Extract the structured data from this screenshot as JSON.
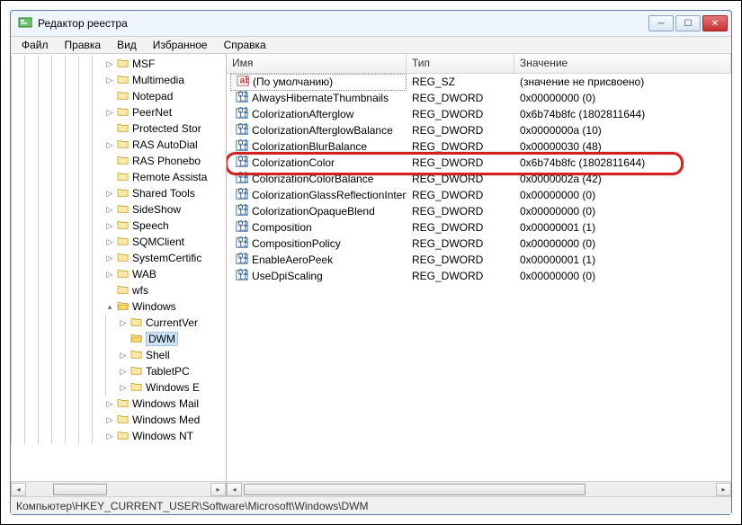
{
  "window": {
    "title": "Редактор реестра"
  },
  "menu": {
    "file": "Файл",
    "edit": "Правка",
    "view": "Вид",
    "favorites": "Избранное",
    "help": "Справка"
  },
  "columns": {
    "name": "Имя",
    "type": "Тип",
    "value": "Значение"
  },
  "tree": {
    "items": [
      {
        "label": "MSF",
        "depth": 7,
        "exp": "▷"
      },
      {
        "label": "Multimedia",
        "depth": 7,
        "exp": "▷"
      },
      {
        "label": "Notepad",
        "depth": 7,
        "exp": ""
      },
      {
        "label": "PeerNet",
        "depth": 7,
        "exp": "▷"
      },
      {
        "label": "Protected Stor",
        "depth": 7,
        "exp": ""
      },
      {
        "label": "RAS AutoDial",
        "depth": 7,
        "exp": "▷"
      },
      {
        "label": "RAS Phonebo",
        "depth": 7,
        "exp": ""
      },
      {
        "label": "Remote Assista",
        "depth": 7,
        "exp": ""
      },
      {
        "label": "Shared Tools",
        "depth": 7,
        "exp": "▷"
      },
      {
        "label": "SideShow",
        "depth": 7,
        "exp": "▷"
      },
      {
        "label": "Speech",
        "depth": 7,
        "exp": "▷"
      },
      {
        "label": "SQMClient",
        "depth": 7,
        "exp": "▷"
      },
      {
        "label": "SystemCertific",
        "depth": 7,
        "exp": "▷"
      },
      {
        "label": "WAB",
        "depth": 7,
        "exp": "▷"
      },
      {
        "label": "wfs",
        "depth": 7,
        "exp": ""
      },
      {
        "label": "Windows",
        "depth": 7,
        "exp": "▴",
        "open": true
      },
      {
        "label": "CurrentVer",
        "depth": 8,
        "exp": "▷"
      },
      {
        "label": "DWM",
        "depth": 8,
        "exp": "",
        "selected": true,
        "open": true
      },
      {
        "label": "Shell",
        "depth": 8,
        "exp": "▷"
      },
      {
        "label": "TabletPC",
        "depth": 8,
        "exp": "▷"
      },
      {
        "label": "Windows E",
        "depth": 8,
        "exp": "▷"
      },
      {
        "label": "Windows Mail",
        "depth": 7,
        "exp": "▷"
      },
      {
        "label": "Windows Med",
        "depth": 7,
        "exp": "▷"
      },
      {
        "label": "Windows NT",
        "depth": 7,
        "exp": "▷"
      }
    ]
  },
  "values": [
    {
      "icon": "sz",
      "name": "(По умолчанию)",
      "type": "REG_SZ",
      "value": "(значение не присвоено)",
      "selected": true
    },
    {
      "icon": "dw",
      "name": "AlwaysHibernateThumbnails",
      "type": "REG_DWORD",
      "value": "0x00000000 (0)"
    },
    {
      "icon": "dw",
      "name": "ColorizationAfterglow",
      "type": "REG_DWORD",
      "value": "0x6b74b8fc (1802811644)"
    },
    {
      "icon": "dw",
      "name": "ColorizationAfterglowBalance",
      "type": "REG_DWORD",
      "value": "0x0000000a (10)"
    },
    {
      "icon": "dw",
      "name": "ColorizationBlurBalance",
      "type": "REG_DWORD",
      "value": "0x00000030 (48)"
    },
    {
      "icon": "dw",
      "name": "ColorizationColor",
      "type": "REG_DWORD",
      "value": "0x6b74b8fc (1802811644)",
      "highlighted": true
    },
    {
      "icon": "dw",
      "name": "ColorizationColorBalance",
      "type": "REG_DWORD",
      "value": "0x0000002a (42)"
    },
    {
      "icon": "dw",
      "name": "ColorizationGlassReflectionIntensity",
      "type": "REG_DWORD",
      "value": "0x00000000 (0)"
    },
    {
      "icon": "dw",
      "name": "ColorizationOpaqueBlend",
      "type": "REG_DWORD",
      "value": "0x00000000 (0)"
    },
    {
      "icon": "dw",
      "name": "Composition",
      "type": "REG_DWORD",
      "value": "0x00000001 (1)"
    },
    {
      "icon": "dw",
      "name": "CompositionPolicy",
      "type": "REG_DWORD",
      "value": "0x00000000 (0)"
    },
    {
      "icon": "dw",
      "name": "EnableAeroPeek",
      "type": "REG_DWORD",
      "value": "0x00000001 (1)"
    },
    {
      "icon": "dw",
      "name": "UseDpiScaling",
      "type": "REG_DWORD",
      "value": "0x00000000 (0)"
    }
  ],
  "statusbar": {
    "path": "Компьютер\\HKEY_CURRENT_USER\\Software\\Microsoft\\Windows\\DWM"
  }
}
